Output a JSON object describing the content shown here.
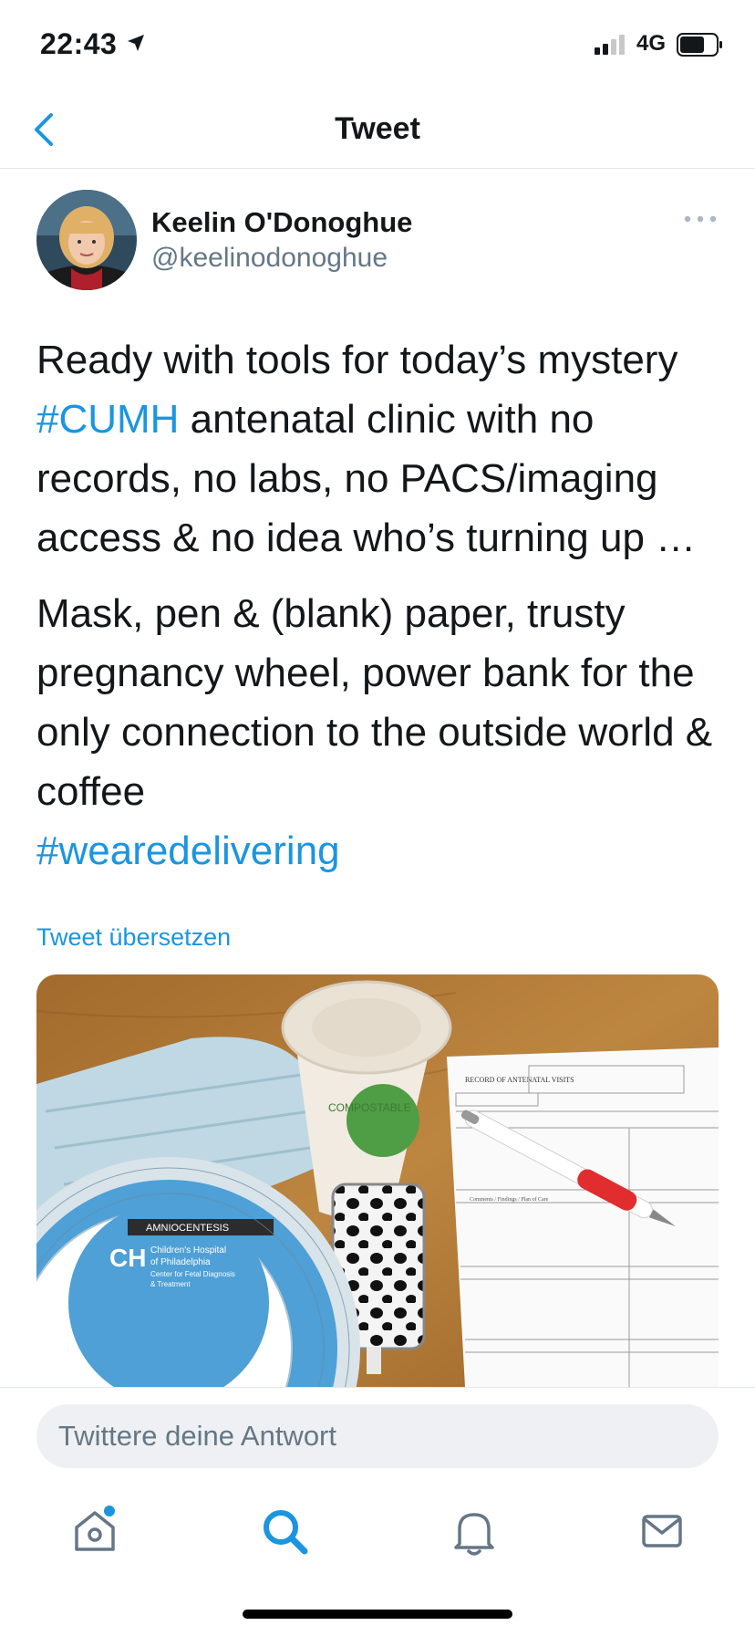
{
  "status_bar": {
    "time": "22:43",
    "network": "4G"
  },
  "nav": {
    "title": "Tweet"
  },
  "tweet": {
    "author": {
      "name": "Keelin O'Donoghue",
      "handle": "@keelinodonoghue"
    },
    "paragraph1": {
      "pre": "Ready with tools for today’s mystery ",
      "hashtag": "#CUMH",
      "post": " antenatal clinic with no records, no labs, no PACS/imaging access & no idea who’s turning up …"
    },
    "paragraph2": "Mask, pen & (blank) paper, trusty pregnancy wheel, power bank for the only connection to the outside world & coffee",
    "hashtag2": "#wearedelivering",
    "translate_label": "Tweet übersetzen"
  },
  "photo": {
    "wheel_line1": "Children's Hospital",
    "wheel_line2": "of Philadelphia",
    "wheel_line3": "Center for Fetal Diagnosis",
    "wheel_line4": "& Treatment",
    "wheel_label": "AMNIOCENTESIS",
    "cup_text": "COMPOSTABLE",
    "form_title": "RECORD OF ANTENATAL VISITS",
    "form_comments": "Comments / Findings / Plan of Care"
  },
  "reply": {
    "placeholder": "Twittere deine Antwort"
  },
  "tabbar": {
    "items": [
      "home-icon",
      "search-icon",
      "notifications-icon",
      "messages-icon"
    ]
  },
  "colors": {
    "accent": "#1b95e0",
    "text": "#14171a",
    "secondary": "#657786"
  }
}
